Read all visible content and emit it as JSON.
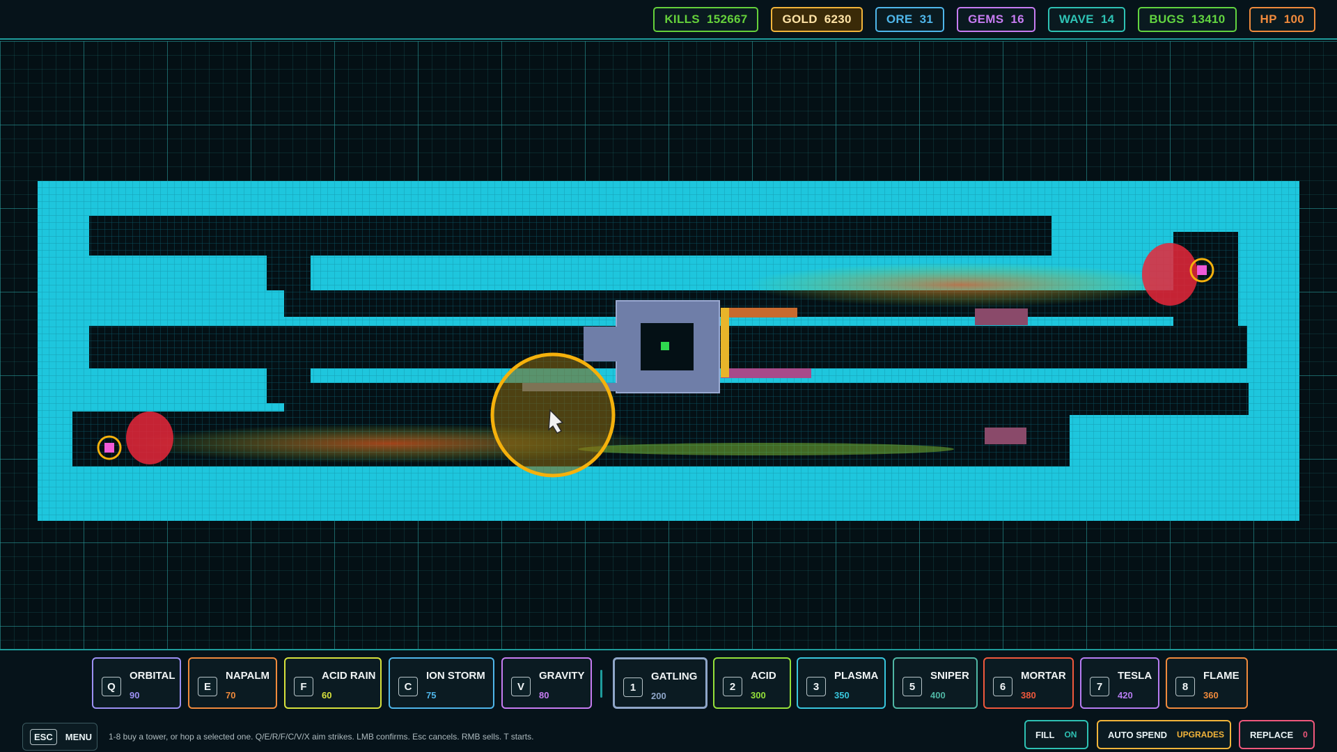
{
  "hud": {
    "stats": [
      {
        "label": "KILLS",
        "value": "152667",
        "color": "#65d13b"
      },
      {
        "label": "GOLD",
        "value": "6230",
        "color": "#f3b53a"
      },
      {
        "label": "ORE",
        "value": "31",
        "color": "#4fb6ea"
      },
      {
        "label": "GEMS",
        "value": "16",
        "color": "#c77cf2"
      },
      {
        "label": "WAVE",
        "value": "14",
        "color": "#2ec2b4"
      },
      {
        "label": "BUGS",
        "value": "13410",
        "color": "#62d440"
      },
      {
        "label": "HP",
        "value": "100",
        "color": "#f08a3c"
      }
    ]
  },
  "strikes": [
    {
      "key": "Q",
      "label": "ORBITAL",
      "cost": "90",
      "color": "#9c90f4"
    },
    {
      "key": "E",
      "label": "NAPALM",
      "cost": "70",
      "color": "#f08a3c"
    },
    {
      "key": "F",
      "label": "ACID RAIN",
      "cost": "60",
      "color": "#d8e23c"
    },
    {
      "key": "C",
      "label": "ION STORM",
      "cost": "75",
      "color": "#4fb6ea"
    },
    {
      "key": "V",
      "label": "GRAVITY",
      "cost": "80",
      "color": "#c77cf2"
    }
  ],
  "towers": [
    {
      "key": "1",
      "label": "GATLING",
      "cost": "200",
      "color": "#8fa6c8",
      "selected": true
    },
    {
      "key": "2",
      "label": "ACID",
      "cost": "300",
      "color": "#95e13a"
    },
    {
      "key": "3",
      "label": "PLASMA",
      "cost": "350",
      "color": "#38c6dd"
    },
    {
      "key": "5",
      "label": "SNIPER",
      "cost": "400",
      "color": "#4fb6a4"
    },
    {
      "key": "6",
      "label": "MORTAR",
      "cost": "380",
      "color": "#f0583c"
    },
    {
      "key": "7",
      "label": "TESLA",
      "cost": "420",
      "color": "#b77cf2"
    },
    {
      "key": "8",
      "label": "FLAME",
      "cost": "360",
      "color": "#f08a3c"
    }
  ],
  "menu": {
    "key": "ESC",
    "label": "MENU"
  },
  "help_text": "1-8 buy a tower, or hop a selected one. Q/E/R/F/C/V/X aim strikes. LMB confirms. Esc cancels. RMB sells. T starts.",
  "options": {
    "fill": {
      "label": "FILL",
      "value": "ON",
      "color": "#2ec2b4"
    },
    "auto_spend": {
      "label": "AUTO SPEND",
      "value": "UPGRADES",
      "color": "#f3b53a"
    },
    "replace": {
      "label": "REPLACE",
      "value": "0",
      "color": "#f0587c"
    }
  },
  "colors": {
    "wall": "#1ec6dd",
    "grid": "#1e9c9c",
    "selection_ring": "#f5b10c",
    "enemy_hot": "#e8273a"
  }
}
